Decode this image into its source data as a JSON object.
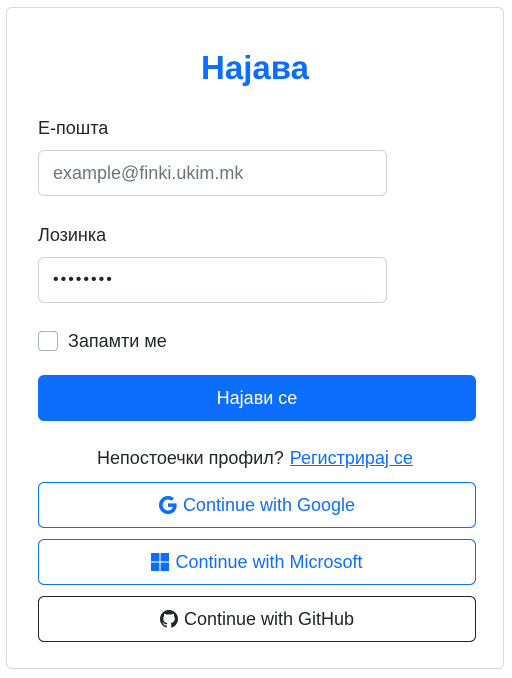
{
  "login": {
    "title": "Најава",
    "email_label": "Е-пошта",
    "email_placeholder": "example@finki.ukim.mk",
    "password_label": "Лозинка",
    "password_value": "••••••••",
    "remember_label": "Запамти ме",
    "submit_label": "Најави се",
    "no_account_text": "Непостоечки профил?",
    "register_link": "Регистрирај се"
  },
  "oauth": {
    "google_label": "Continue with Google",
    "microsoft_label": "Continue with Microsoft",
    "github_label": "Continue with GitHub",
    "google_icon": "google-icon",
    "microsoft_icon": "microsoft-icon",
    "github_icon": "github-icon"
  },
  "colors": {
    "primary": "#0d6efd",
    "dark": "#212529",
    "border": "#ced4da"
  }
}
